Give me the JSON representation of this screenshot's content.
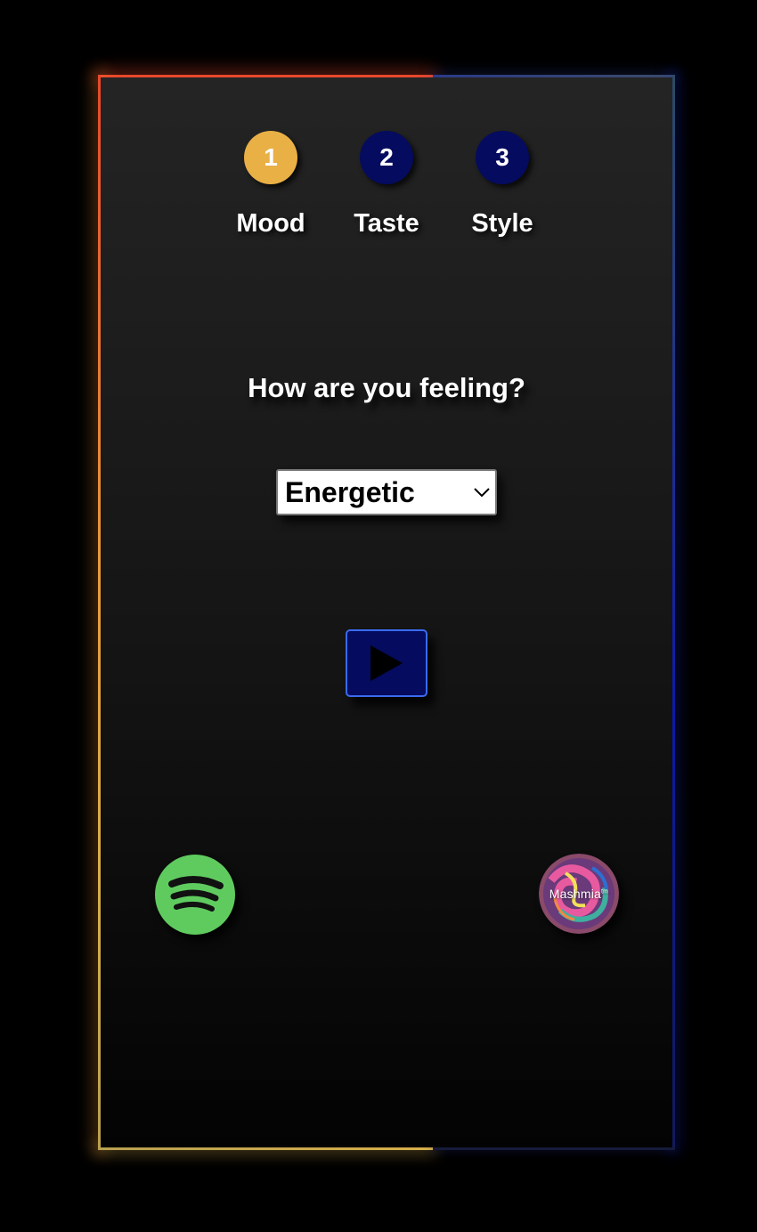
{
  "steps": [
    {
      "number": "1",
      "label": "Mood",
      "active": true
    },
    {
      "number": "2",
      "label": "Taste",
      "active": false
    },
    {
      "number": "3",
      "label": "Style",
      "active": false
    }
  ],
  "question": "How are you feeling?",
  "mood_select": {
    "value": "Energetic"
  },
  "icons": {
    "play": "play-icon",
    "spotify": "spotify-logo",
    "mashmia": "mashmia-logo",
    "chevron": "chevron-down-icon"
  },
  "brand": {
    "mashmia_label": "Mashmia",
    "mashmia_tm": "tm"
  },
  "colors": {
    "active_step": "#e9b046",
    "inactive_step": "#050b5e",
    "play_border": "#3a6bf0",
    "spotify_green": "#5fcb5f"
  }
}
